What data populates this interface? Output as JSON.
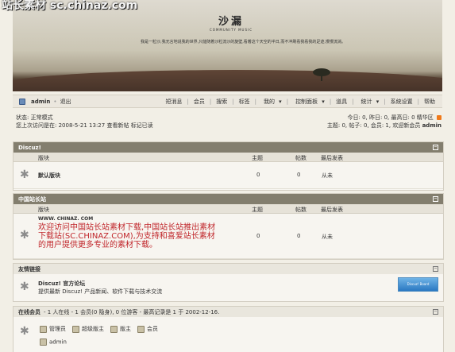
{
  "watermark_top": "站长素材 sc.chinaz.com",
  "banner": {
    "logo_title": "沙漏",
    "logo_subtitle": "COMMUNITY MUSIC",
    "tagline": "我是一粒沙,我无言地说我的世界,只能随着沙粒流沙的旋壁,看着这个天空的半日,而不冲刷看我看我的足迹,慢慢流淌。"
  },
  "navbar": {
    "user": "admin",
    "logout": "退出",
    "links": [
      "短消息",
      "会员",
      "搜索",
      "标签",
      "我的",
      "控制面板",
      "道具",
      "统计",
      "系统设置",
      "帮助"
    ]
  },
  "info": {
    "status_label": "状态: 正常模式",
    "last_visit": "您上次访问是在: 2008-5-21 13:27",
    "view_new": "查看新帖",
    "mark_read": "标记已读",
    "stats_line1": "今日: 0, 昨日: 0, 最高日: 0",
    "digest": "精华区",
    "stats_line2": "主题: 0, 帖子: 0, 会员: 1, 欢迎新会员",
    "newest_member": "admin"
  },
  "columns": {
    "forum": "版块",
    "topics": "主题",
    "posts": "帖数",
    "last": "最后发表"
  },
  "sections": [
    {
      "title": "Discuz!",
      "forums": [
        {
          "name": "默认版块",
          "topics": "0",
          "posts": "0",
          "last": "从未"
        }
      ]
    },
    {
      "title": "中国站长站",
      "forums": [
        {
          "name": "WWW. CHINAZ. COM",
          "desc": "欢迎访问中国站长站素材下载,中国站长站推出素材下载站(SC.CHINAZ.COM),为支持和喜爱站长素材的用户提供更多专业的素材下载。",
          "topics": "0",
          "posts": "0",
          "last": "从未"
        }
      ]
    }
  ],
  "links_section": {
    "title": "友情链接",
    "name": "Discuz! 官方论坛",
    "desc": "提供最新 Discuz! 产品新闻、软件下载与技术交流",
    "badge": "Discuz! Board"
  },
  "online": {
    "title": "在线会员",
    "summary": "- 1 人在线 - 1 会员(0 隐身), 0 位游客 - 最高记录是 1 于 2002-12-16.",
    "legend": [
      "管理员",
      "超级版主",
      "版主",
      "会员"
    ],
    "user": "admin"
  }
}
